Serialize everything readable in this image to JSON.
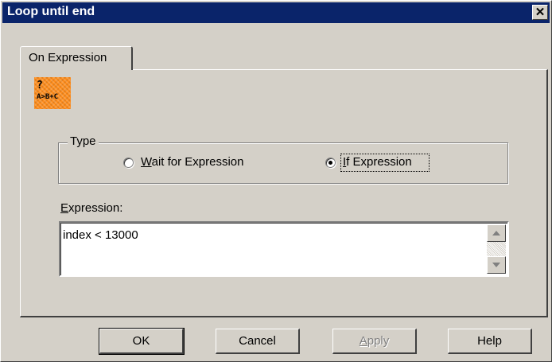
{
  "window": {
    "title": "Loop until end"
  },
  "tabs": [
    {
      "label": "On Expression",
      "selected": true
    }
  ],
  "icon": {
    "name": "expression-icon",
    "top_text": "?",
    "bottom_text": "A>B+C",
    "color": "#ff8c1a"
  },
  "type_group": {
    "legend": "Type",
    "options": [
      {
        "label_mnemonic": "W",
        "label_rest": "ait for Expression",
        "selected": false
      },
      {
        "label_mnemonic": "I",
        "label_rest": "f Expression",
        "selected": true
      }
    ]
  },
  "expression": {
    "label_mnemonic": "E",
    "label_rest": "xpression:",
    "value": "index < 13000"
  },
  "buttons": {
    "ok": "OK",
    "cancel": "Cancel",
    "apply_mnemonic": "A",
    "apply_rest": "pply",
    "help": "Help"
  },
  "colors": {
    "titlebar": "#0a246a",
    "face": "#d4d0c8"
  }
}
